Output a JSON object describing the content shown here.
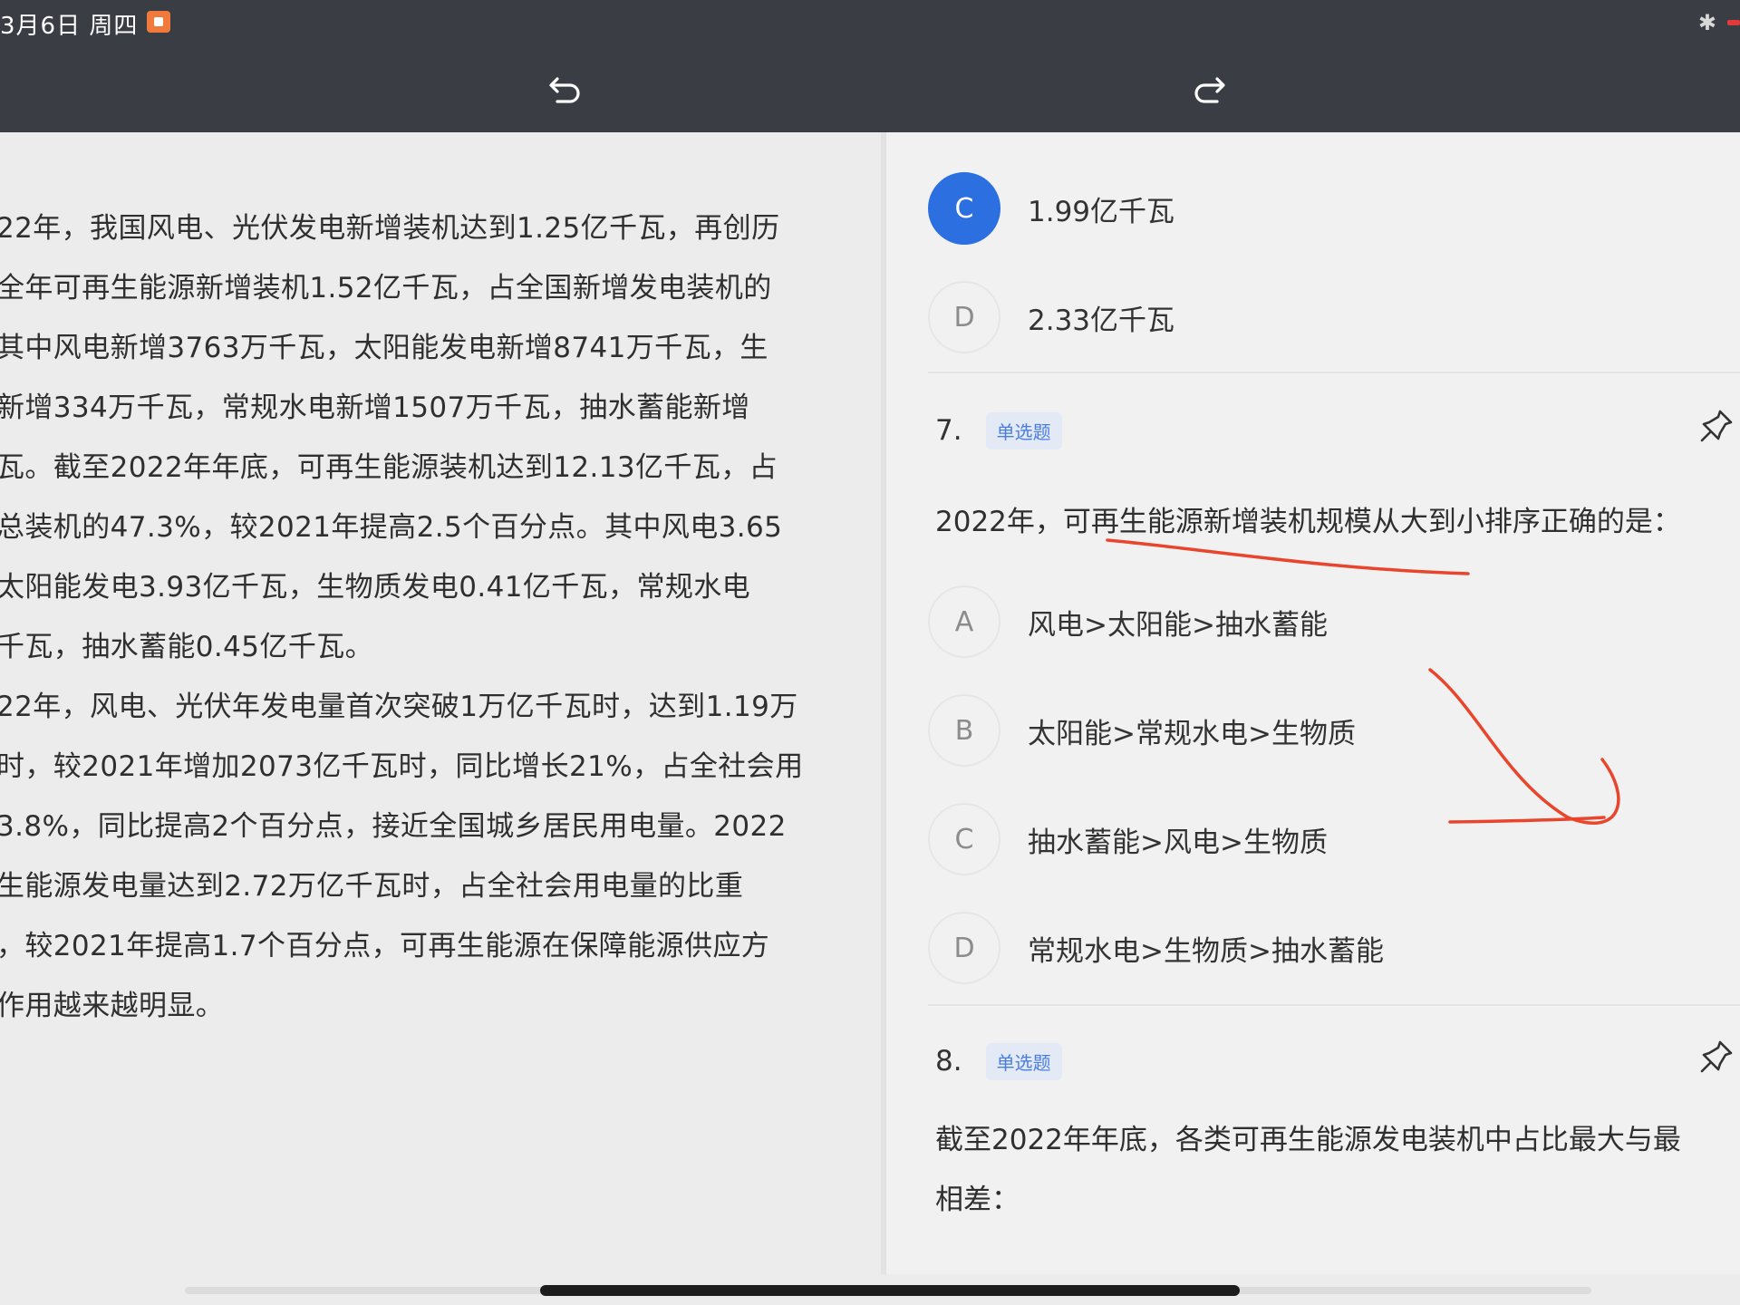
{
  "status_bar": {
    "date": "3月6日 周四",
    "colors": {
      "badge": "#f07a3c",
      "battery": "#e23a3a"
    }
  },
  "toolbar": {
    "undo_icon": "undo-arrow-icon",
    "redo_icon": "redo-arrow-icon"
  },
  "passage": {
    "lines": [
      "22年，我国风电、光伏发电新增装机达到1.25亿千瓦，再创历",
      "全年可再生能源新增装机1.52亿千瓦，占全国新增发电装机的",
      "其中风电新增3763万千瓦，太阳能发电新增8741万千瓦，生",
      "新增334万千瓦，常规水电新增1507万千瓦，抽水蓄能新增",
      "瓦。截至2022年年底，可再生能源装机达到12.13亿千瓦，占",
      "总装机的47.3%，较2021年提高2.5个百分点。其中风电3.65",
      "太阳能发电3.93亿千瓦，生物质发电0.41亿千瓦，常规水电",
      "千瓦，抽水蓄能0.45亿千瓦。",
      "22年，风电、光伏年发电量首次突破1万亿千瓦时，达到1.19万",
      "时，较2021年增加2073亿千瓦时，同比增长21%，占全社会用",
      "3.8%，同比提高2个百分点，接近全国城乡居民用电量。2022",
      "生能源发电量达到2.72万亿千瓦时，占全社会用电量的比重",
      "，较2021年提高1.7个百分点，可再生能源在保障能源供应方",
      "作用越来越明显。"
    ]
  },
  "question6": {
    "options": [
      {
        "letter": "C",
        "text": "1.99亿千瓦",
        "selected": true
      },
      {
        "letter": "D",
        "text": "2.33亿千瓦",
        "selected": false
      }
    ]
  },
  "question7": {
    "number": "7.",
    "tag": "单选题",
    "stem": "2022年，可再生能源新增装机规模从大到小排序正确的是：",
    "options": [
      {
        "letter": "A",
        "text": "风电>太阳能>抽水蓄能"
      },
      {
        "letter": "B",
        "text": "太阳能>常规水电>生物质"
      },
      {
        "letter": "C",
        "text": "抽水蓄能>风电>生物质"
      },
      {
        "letter": "D",
        "text": "常规水电>生物质>抽水蓄能"
      }
    ]
  },
  "question8": {
    "number": "8.",
    "tag": "单选题",
    "stem_line1": "截至2022年年底，各类可再生能源发电装机中占比最大与最",
    "stem_line2": "相差："
  },
  "colors": {
    "selected_option": "#2b6fe0",
    "annotation_ink": "#e8452c",
    "tag_text": "#4a7de0"
  }
}
